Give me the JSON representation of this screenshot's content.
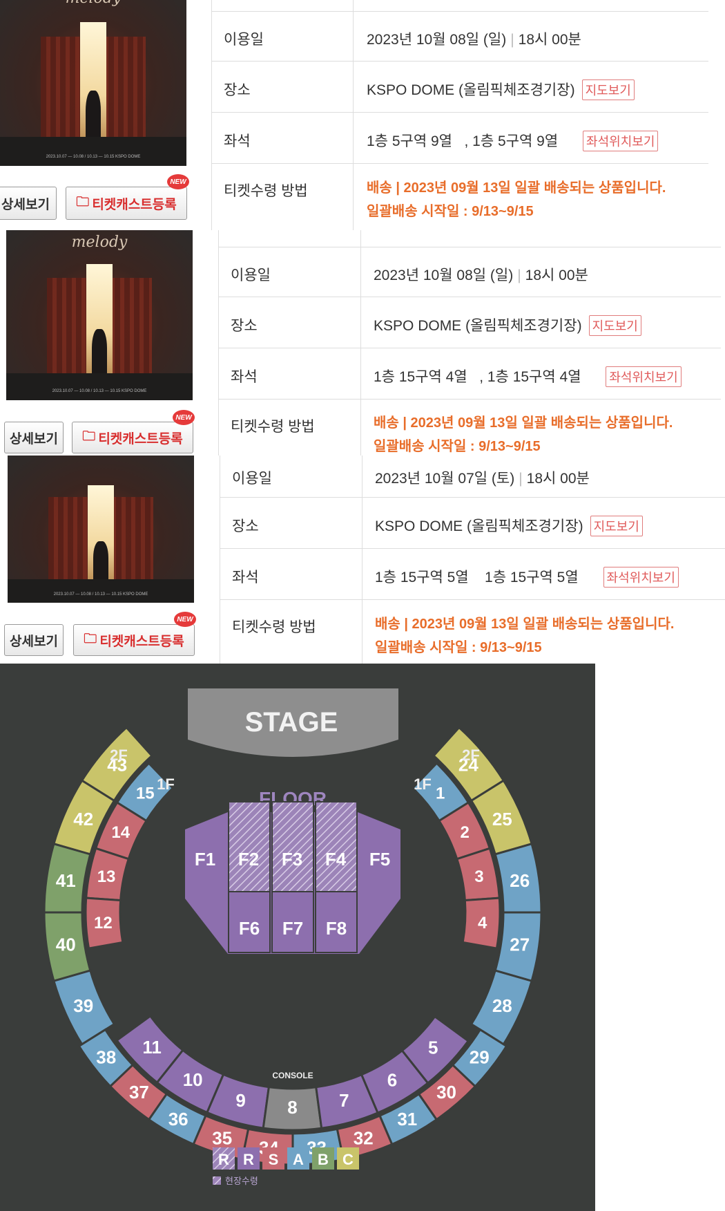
{
  "poster_title": "melody",
  "poster_footer": "2023.10.07 — 10.08 / 10.13 — 10.15  KSPO DOME",
  "buttons": {
    "detail": "상세보기",
    "ticketcast": "티켓캐스트등록",
    "new_badge": "NEW"
  },
  "labels": {
    "date": "이용일",
    "venue": "장소",
    "seat": "좌석",
    "delivery": "티켓수령 방법"
  },
  "map_link": "지도보기",
  "seat_link": "좌석위치보기",
  "orders": [
    {
      "date": "2023년 10월 08일 (일)",
      "time": "18시 00분",
      "venue": "KSPO DOME (올림픽체조경기장)",
      "seat1": "1층 5구역 9열",
      "seat2": ", 1층 5구역 9열",
      "delivery_line1": "배송 | 2023년 09월 13일 일괄 배송되는 상품입니다.",
      "delivery_line2": "일괄배송 시작일 : 9/13~9/15"
    },
    {
      "date": "2023년 10월 08일 (일)",
      "time": "18시 00분",
      "venue": "KSPO DOME (올림픽체조경기장)",
      "seat1": "1층 15구역 4열",
      "seat2": ", 1층 15구역 4열",
      "delivery_line1": "배송 | 2023년 09월 13일 일괄 배송되는 상품입니다.",
      "delivery_line2": "일괄배송 시작일 : 9/13~9/15"
    },
    {
      "date": "2023년 10월 07일 (토)",
      "time": "18시 00분",
      "venue": "KSPO DOME (올림픽체조경기장)",
      "seat1": "1층 15구역 5열",
      "seat2": "1층 15구역 5열",
      "delivery_line1": "배송 | 2023년 09월 13일 일괄 배송되는 상품입니다.",
      "delivery_line2": "일괄배송 시작일 : 9/13~9/15"
    }
  ],
  "seat_map": {
    "stage": "STAGE",
    "floor_label": "FLOOR",
    "console": "CONSOLE",
    "level_2f": "2F",
    "level_1f": "1F",
    "floor_sections_top": [
      "F1",
      "F2",
      "F3",
      "F4",
      "F5"
    ],
    "floor_sections_bottom": [
      "F6",
      "F7",
      "F8"
    ],
    "left_1f": [
      "15",
      "14",
      "13",
      "12"
    ],
    "right_1f": [
      "1",
      "2",
      "3",
      "4"
    ],
    "left_2f": [
      "43",
      "42",
      "41",
      "40",
      "39"
    ],
    "right_2f": [
      "24",
      "25",
      "26",
      "27",
      "28"
    ],
    "inner_ring": [
      "11",
      "10",
      "9",
      "8",
      "7",
      "6",
      "5"
    ],
    "outer_ring": [
      "38",
      "37",
      "36",
      "35",
      "34",
      "33",
      "32",
      "31",
      "30",
      "29"
    ],
    "legend": [
      "R",
      "R",
      "S",
      "A",
      "B",
      "C"
    ],
    "legend_note": "현장수령",
    "colors": {
      "R": "#8d6fae",
      "Rstriped": "#9c84b8",
      "S": "#c76a72",
      "A": "#6fa3c6",
      "B": "#7fa16a",
      "C": "#c9c46a",
      "console": "#8a8a8a"
    }
  }
}
